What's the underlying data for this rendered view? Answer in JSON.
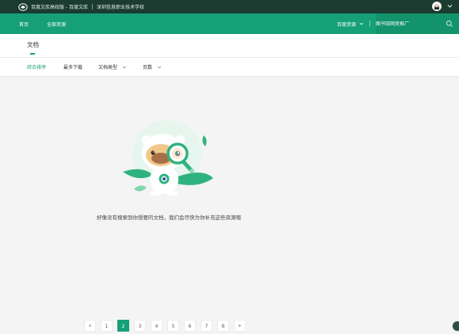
{
  "topbar": {
    "site_title": "百度文库高校版 - 百度文库",
    "school_name": "深圳信息职业技术学校"
  },
  "navbar": {
    "items": [
      {
        "label": "首页"
      },
      {
        "label": "全部资源"
      }
    ],
    "resource_dropdown": "百度资源",
    "search": {
      "placeholder": "图书馆网资推广"
    }
  },
  "tabs": {
    "active_label": "文档"
  },
  "filters": [
    {
      "label": "综合排序",
      "active": true
    },
    {
      "label": "最多下载",
      "active": false
    },
    {
      "label": "文档类型",
      "active": false
    },
    {
      "label": "页数",
      "active": false
    }
  ],
  "empty_state": {
    "message": "好像没有搜索到你想要的文档，我们会尽快为你补充这些资源哦"
  },
  "pagination": {
    "pages": [
      "1",
      "2",
      "3",
      "4",
      "5",
      "6",
      "7",
      "8"
    ],
    "current": "2"
  },
  "colors": {
    "brand_green": "#15a077",
    "topbar_dark": "#1b3b31"
  }
}
